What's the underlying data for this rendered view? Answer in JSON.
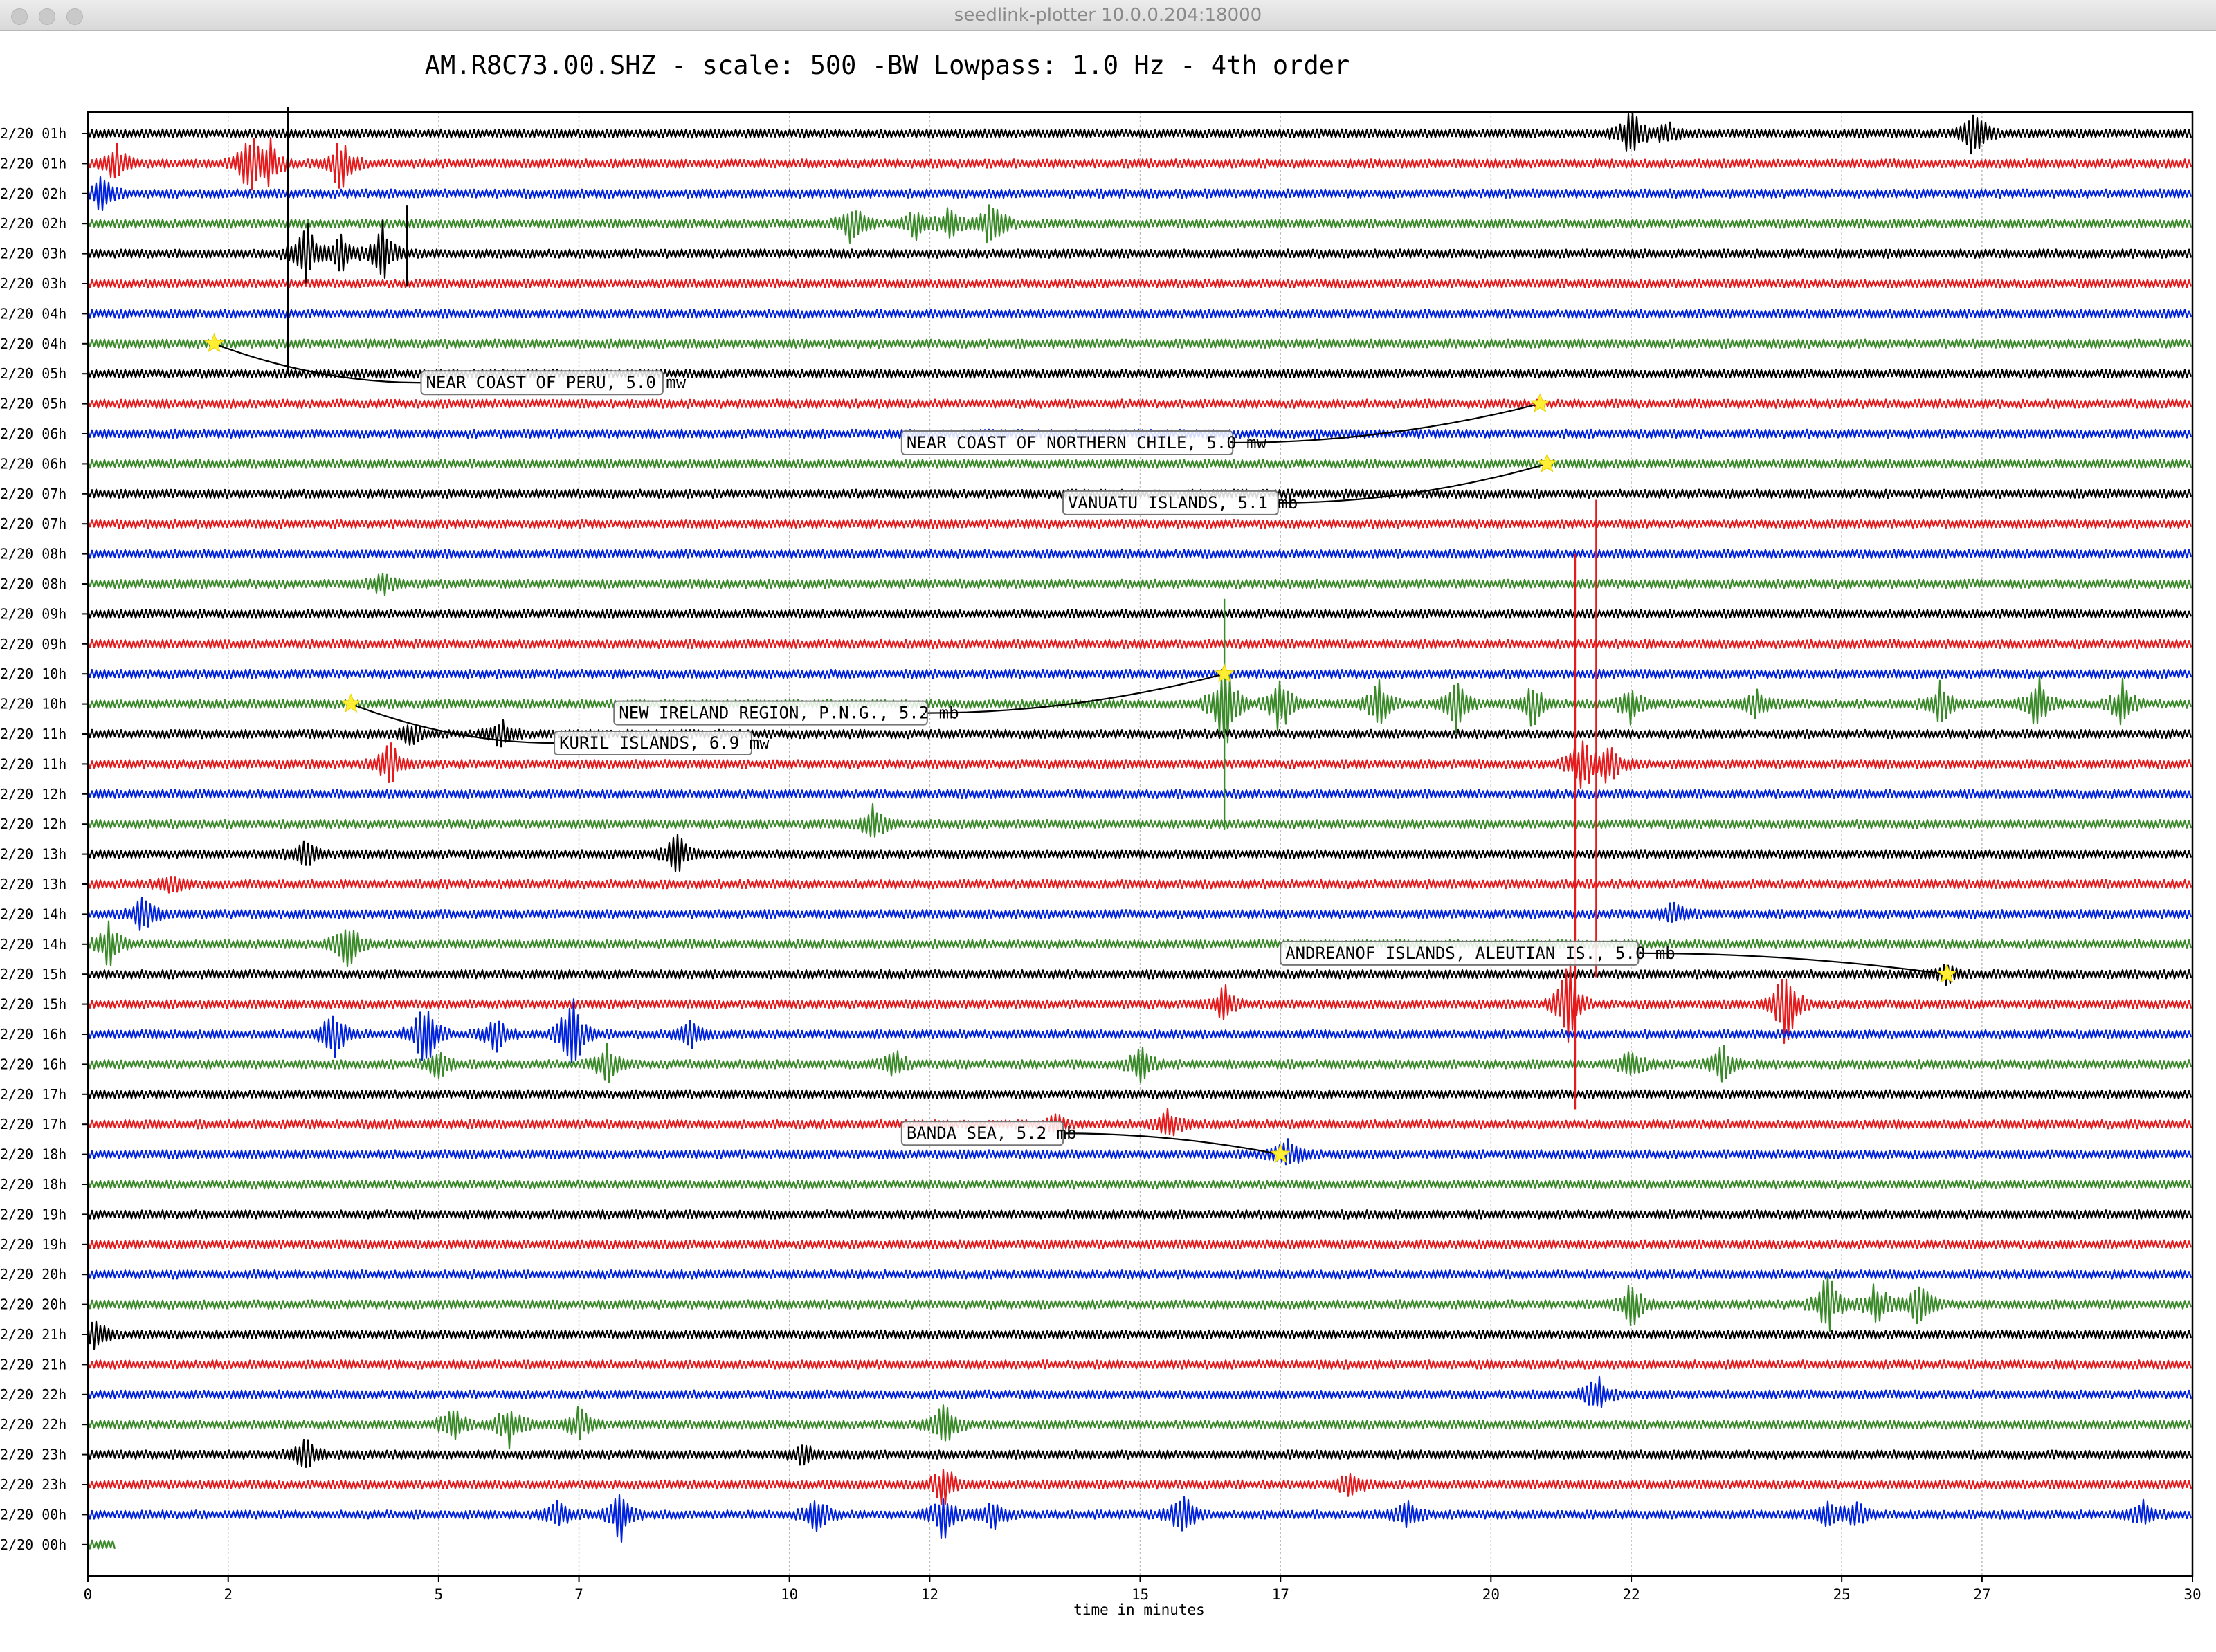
{
  "window": {
    "title": "seedlink-plotter 10.0.0.204:18000",
    "title_bar_color": "#e2e2e2"
  },
  "chart_data": {
    "type": "line",
    "title": "AM.R8C73.00.SHZ - scale: 500 -BW Lowpass: 1.0 Hz - 4th order",
    "xlabel": "time in minutes",
    "ylabel": "",
    "xlim": [
      0,
      30
    ],
    "x_ticks": [
      0,
      2,
      5,
      7,
      10,
      12,
      15,
      17,
      20,
      22,
      25,
      27,
      30
    ],
    "x_grid": true,
    "line_colors": [
      "#000000",
      "#e41a1c",
      "#0022dd",
      "#3a8a2a"
    ],
    "rows": [
      "2/20 01h",
      "2/20 01h",
      "2/20 02h",
      "2/20 02h",
      "2/20 03h",
      "2/20 03h",
      "2/20 04h",
      "2/20 04h",
      "2/20 05h",
      "2/20 05h",
      "2/20 06h",
      "2/20 06h",
      "2/20 07h",
      "2/20 07h",
      "2/20 08h",
      "2/20 08h",
      "2/20 09h",
      "2/20 09h",
      "2/20 10h",
      "2/20 10h",
      "2/20 11h",
      "2/20 11h",
      "2/20 12h",
      "2/20 12h",
      "2/20 13h",
      "2/20 13h",
      "2/20 14h",
      "2/20 14h",
      "2/20 15h",
      "2/20 15h",
      "2/20 16h",
      "2/20 16h",
      "2/20 17h",
      "2/20 17h",
      "2/20 18h",
      "2/20 18h",
      "2/20 19h",
      "2/20 19h",
      "2/20 20h",
      "2/20 20h",
      "2/20 21h",
      "2/20 21h",
      "2/20 22h",
      "2/20 22h",
      "2/20 23h",
      "2/20 23h",
      "2/20 00h",
      "2/20 00h"
    ],
    "last_row_end_minute": 0.4,
    "bursts": [
      {
        "row": 0,
        "minute": 22.0,
        "amp": 1.2
      },
      {
        "row": 0,
        "minute": 22.5,
        "amp": 0.5
      },
      {
        "row": 0,
        "minute": 26.9,
        "amp": 1.2
      },
      {
        "row": 1,
        "minute": 0.4,
        "amp": 0.8
      },
      {
        "row": 1,
        "minute": 2.3,
        "amp": 1.5
      },
      {
        "row": 1,
        "minute": 2.6,
        "amp": 1.0
      },
      {
        "row": 1,
        "minute": 3.6,
        "amp": 1.2
      },
      {
        "row": 2,
        "minute": 0.2,
        "amp": 0.8
      },
      {
        "row": 3,
        "minute": 10.9,
        "amp": 1.0
      },
      {
        "row": 3,
        "minute": 11.8,
        "amp": 0.6
      },
      {
        "row": 3,
        "minute": 12.3,
        "amp": 0.8
      },
      {
        "row": 3,
        "minute": 12.9,
        "amp": 1.3
      },
      {
        "row": 4,
        "minute": 3.1,
        "amp": 1.6
      },
      {
        "row": 4,
        "minute": 3.6,
        "amp": 0.8
      },
      {
        "row": 4,
        "minute": 4.2,
        "amp": 1.4
      },
      {
        "row": 15,
        "minute": 4.2,
        "amp": 0.5
      },
      {
        "row": 19,
        "minute": 16.2,
        "amp": 2.5
      },
      {
        "row": 19,
        "minute": 17.0,
        "amp": 1.4
      },
      {
        "row": 19,
        "minute": 18.4,
        "amp": 1.1
      },
      {
        "row": 19,
        "minute": 19.5,
        "amp": 1.3
      },
      {
        "row": 19,
        "minute": 20.6,
        "amp": 1.0
      },
      {
        "row": 19,
        "minute": 22.0,
        "amp": 0.9
      },
      {
        "row": 19,
        "minute": 23.8,
        "amp": 0.7
      },
      {
        "row": 19,
        "minute": 26.4,
        "amp": 1.0
      },
      {
        "row": 19,
        "minute": 27.8,
        "amp": 1.2
      },
      {
        "row": 19,
        "minute": 29.0,
        "amp": 0.9
      },
      {
        "row": 20,
        "minute": 4.6,
        "amp": 0.5
      },
      {
        "row": 20,
        "minute": 5.9,
        "amp": 0.7
      },
      {
        "row": 21,
        "minute": 4.3,
        "amp": 1.1
      },
      {
        "row": 21,
        "minute": 21.3,
        "amp": 1.4
      },
      {
        "row": 21,
        "minute": 21.7,
        "amp": 1.0
      },
      {
        "row": 23,
        "minute": 11.2,
        "amp": 0.8
      },
      {
        "row": 24,
        "minute": 3.1,
        "amp": 0.6
      },
      {
        "row": 24,
        "minute": 8.4,
        "amp": 0.9
      },
      {
        "row": 25,
        "minute": 1.2,
        "amp": 0.4
      },
      {
        "row": 26,
        "minute": 0.8,
        "amp": 1.0
      },
      {
        "row": 26,
        "minute": 22.6,
        "amp": 0.5
      },
      {
        "row": 27,
        "minute": 0.3,
        "amp": 1.0
      },
      {
        "row": 27,
        "minute": 3.7,
        "amp": 1.2
      },
      {
        "row": 28,
        "minute": 26.5,
        "amp": 0.4
      },
      {
        "row": 29,
        "minute": 16.2,
        "amp": 0.8
      },
      {
        "row": 29,
        "minute": 21.1,
        "amp": 2.1
      },
      {
        "row": 29,
        "minute": 24.2,
        "amp": 2.0
      },
      {
        "row": 30,
        "minute": 3.5,
        "amp": 1.3
      },
      {
        "row": 30,
        "minute": 4.8,
        "amp": 1.8
      },
      {
        "row": 30,
        "minute": 5.8,
        "amp": 0.8
      },
      {
        "row": 30,
        "minute": 6.9,
        "amp": 2.2
      },
      {
        "row": 30,
        "minute": 8.6,
        "amp": 0.6
      },
      {
        "row": 31,
        "minute": 5.0,
        "amp": 0.6
      },
      {
        "row": 31,
        "minute": 7.4,
        "amp": 0.9
      },
      {
        "row": 31,
        "minute": 11.5,
        "amp": 0.6
      },
      {
        "row": 31,
        "minute": 15.0,
        "amp": 0.8
      },
      {
        "row": 31,
        "minute": 22.0,
        "amp": 0.7
      },
      {
        "row": 31,
        "minute": 23.3,
        "amp": 0.8
      },
      {
        "row": 33,
        "minute": 13.8,
        "amp": 0.4
      },
      {
        "row": 33,
        "minute": 15.4,
        "amp": 0.7
      },
      {
        "row": 34,
        "minute": 17.1,
        "amp": 0.8
      },
      {
        "row": 39,
        "minute": 22.0,
        "amp": 1.1
      },
      {
        "row": 39,
        "minute": 24.8,
        "amp": 1.4
      },
      {
        "row": 39,
        "minute": 25.5,
        "amp": 1.2
      },
      {
        "row": 39,
        "minute": 26.1,
        "amp": 1.2
      },
      {
        "row": 40,
        "minute": 0.1,
        "amp": 0.9
      },
      {
        "row": 42,
        "minute": 21.5,
        "amp": 0.9
      },
      {
        "row": 43,
        "minute": 5.2,
        "amp": 0.8
      },
      {
        "row": 43,
        "minute": 6.0,
        "amp": 1.0
      },
      {
        "row": 43,
        "minute": 7.0,
        "amp": 0.7
      },
      {
        "row": 43,
        "minute": 12.2,
        "amp": 1.1
      },
      {
        "row": 44,
        "minute": 3.1,
        "amp": 0.7
      },
      {
        "row": 44,
        "minute": 10.2,
        "amp": 0.4
      },
      {
        "row": 45,
        "minute": 12.2,
        "amp": 1.0
      },
      {
        "row": 45,
        "minute": 18.0,
        "amp": 0.6
      },
      {
        "row": 46,
        "minute": 6.7,
        "amp": 0.6
      },
      {
        "row": 46,
        "minute": 7.6,
        "amp": 1.2
      },
      {
        "row": 46,
        "minute": 10.4,
        "amp": 0.9
      },
      {
        "row": 46,
        "minute": 12.2,
        "amp": 1.1
      },
      {
        "row": 46,
        "minute": 12.9,
        "amp": 0.7
      },
      {
        "row": 46,
        "minute": 15.6,
        "amp": 1.1
      },
      {
        "row": 46,
        "minute": 18.8,
        "amp": 0.6
      },
      {
        "row": 46,
        "minute": 24.8,
        "amp": 0.5
      },
      {
        "row": 46,
        "minute": 25.2,
        "amp": 0.6
      },
      {
        "row": 46,
        "minute": 29.3,
        "amp": 0.5
      }
    ],
    "spikes": [
      {
        "row": 0,
        "minute": 2.85,
        "up": 0.9,
        "down": 8.0,
        "color": "#000000"
      },
      {
        "row": 3,
        "minute": 4.55,
        "up": 0.6,
        "down": 2.1,
        "color": "#000000"
      },
      {
        "row": 19,
        "minute": 16.2,
        "up": 3.5,
        "down": 4.2,
        "color": "#3a8a2a"
      },
      {
        "row": 19,
        "minute": 21.2,
        "up": 5.0,
        "down": 13.5,
        "color": "#e41a1c"
      },
      {
        "row": 19,
        "minute": 21.5,
        "up": 6.8,
        "down": 9.1,
        "color": "#e41a1c"
      }
    ],
    "events": [
      {
        "label": "NEAR COAST OF PERU, 5.0 mw",
        "row": 7,
        "minute": 1.8,
        "label_row": 8.3,
        "label_minute": 4.75
      },
      {
        "label": "NEAR COAST OF NORTHERN CHILE, 5.0 mw",
        "row": 9,
        "minute": 20.7,
        "label_row": 10.3,
        "label_minute": 11.6
      },
      {
        "label": "VANUATU ISLANDS, 5.1 mb",
        "row": 11,
        "minute": 20.8,
        "label_row": 12.3,
        "label_minute": 13.9
      },
      {
        "label": "NEW IRELAND REGION, P.N.G., 5.2 mb",
        "row": 18,
        "minute": 16.2,
        "label_row": 19.3,
        "label_minute": 7.5
      },
      {
        "label": "KURIL ISLANDS, 6.9 mw",
        "row": 19,
        "minute": 3.75,
        "label_row": 20.3,
        "label_minute": 6.65
      },
      {
        "label": "ANDREANOF ISLANDS, ALEUTIAN IS., 5.0 mb",
        "row": 28,
        "minute": 26.5,
        "label_row": 27.3,
        "label_minute": 17.0
      },
      {
        "label": "BANDA SEA, 5.2 mb",
        "row": 34,
        "minute": 17.0,
        "label_row": 33.3,
        "label_minute": 11.6
      }
    ],
    "marker_color": "#ffee33"
  }
}
